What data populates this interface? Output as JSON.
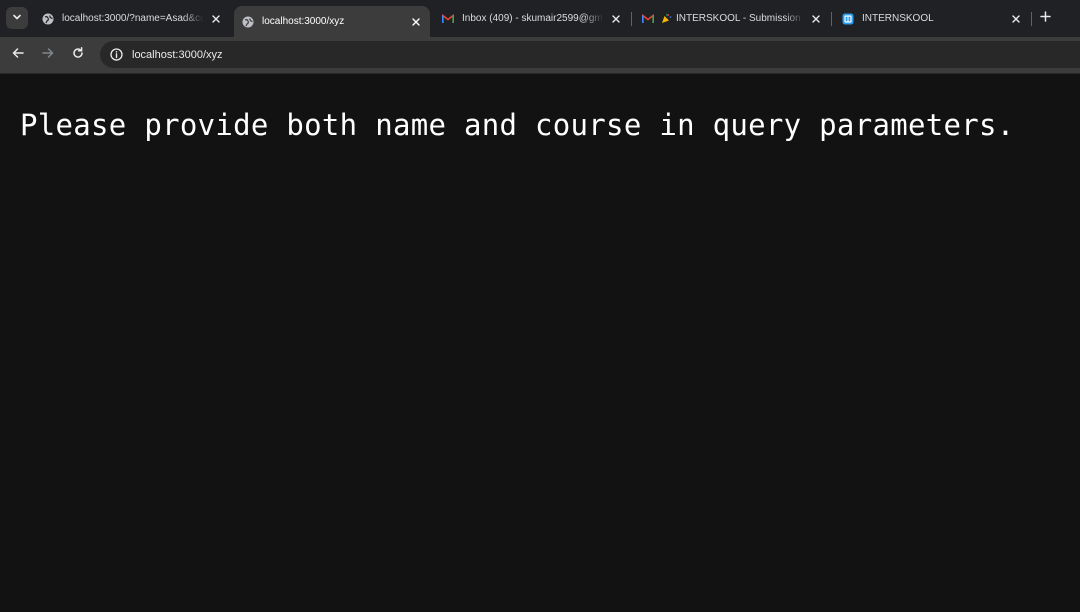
{
  "browser": {
    "tabs": [
      {
        "title": "localhost:3000/?name=Asad&co",
        "favicon": "globe-icon",
        "active": false
      },
      {
        "title": "localhost:3000/xyz",
        "favicon": "globe-icon",
        "active": true
      },
      {
        "title": "Inbox (409) - skumair2599@gm",
        "favicon": "gmail-icon",
        "active": false
      },
      {
        "title": "INTERSKOOL - Submission",
        "favicon": "gmail-icon",
        "active": false
      },
      {
        "title": "INTERNSKOOL",
        "favicon": "internskool-icon",
        "active": false
      }
    ],
    "address_bar": {
      "url": "localhost:3000/xyz"
    },
    "icons": {
      "tab_search": "chevron-down-icon",
      "back": "back-arrow-icon",
      "forward": "forward-arrow-icon",
      "reload": "reload-icon",
      "site_info": "info-icon",
      "new_tab": "plus-icon",
      "close": "close-icon"
    }
  },
  "page": {
    "message": "Please provide both name and course in query parameters."
  },
  "colors": {
    "page_background": "#121212",
    "tabstrip_background": "#202124",
    "toolbar_background": "#3c3c3c",
    "omnibox_background": "#282828",
    "text": "#ffffff"
  }
}
